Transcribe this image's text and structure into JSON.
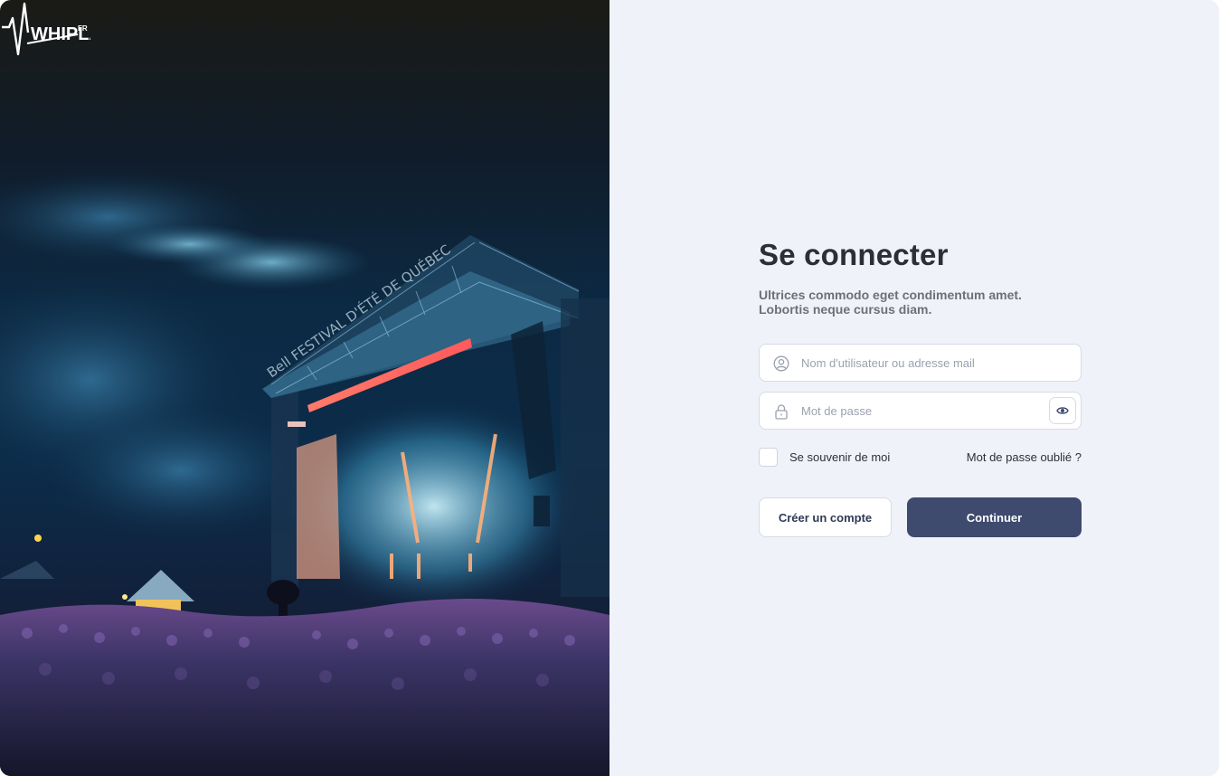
{
  "brand": {
    "logo_text": "WHIPLAY",
    "logo_suffix": "FR"
  },
  "hero": {
    "image": "concert-stage-crowd",
    "stage_banner_text": "Bell FESTIVAL D'ÉTÉ DE QUÉBEC"
  },
  "login": {
    "title": "Se connecter",
    "subtitle_line1": "Ultrices commodo eget condimentum amet.",
    "subtitle_line2": "Lobortis neque cursus diam.",
    "username_placeholder": "Nom d'utilisateur ou adresse mail",
    "username_value": "",
    "password_placeholder": "Mot de passe",
    "password_value": "",
    "remember_label": "Se souvenir de moi",
    "remember_checked": false,
    "forgot_label": "Mot de passe oublié ?",
    "create_account_label": "Créer un compte",
    "continue_label": "Continuer"
  },
  "icons": {
    "user": "user-circle-icon",
    "lock": "lock-icon",
    "eye": "eye-icon"
  },
  "colors": {
    "panel_bg": "#eff2f8",
    "primary_button": "#3e4a6e",
    "title_text": "#2c2f36",
    "subtitle_text": "#6d7078"
  }
}
